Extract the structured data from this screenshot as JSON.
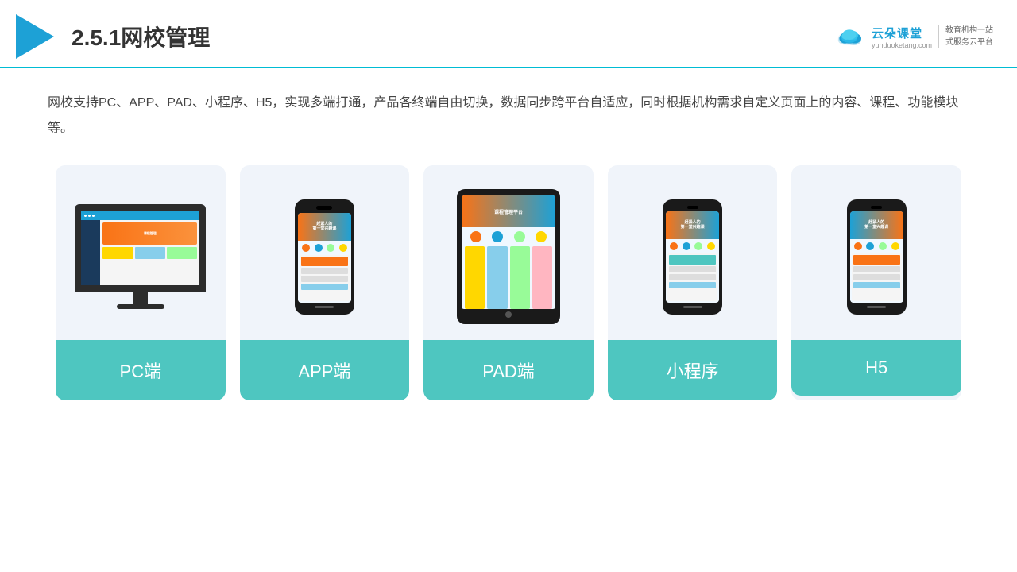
{
  "header": {
    "title_prefix": "2.5.1",
    "title_main": "网校管理",
    "brand_name": "云朵课堂",
    "brand_url": "yunduoketang.com",
    "brand_slogan_line1": "教育机构一站",
    "brand_slogan_line2": "式服务云平台"
  },
  "description": {
    "text": "网校支持PC、APP、PAD、小程序、H5，实现多端打通，产品各终端自由切换，数据同步跨平台自适应，同时根据机构需求自定义页面上的内容、课程、功能模块等。"
  },
  "cards": [
    {
      "id": "pc",
      "label": "PC端"
    },
    {
      "id": "app",
      "label": "APP端"
    },
    {
      "id": "pad",
      "label": "PAD端"
    },
    {
      "id": "miniprogram",
      "label": "小程序"
    },
    {
      "id": "h5",
      "label": "H5"
    }
  ]
}
